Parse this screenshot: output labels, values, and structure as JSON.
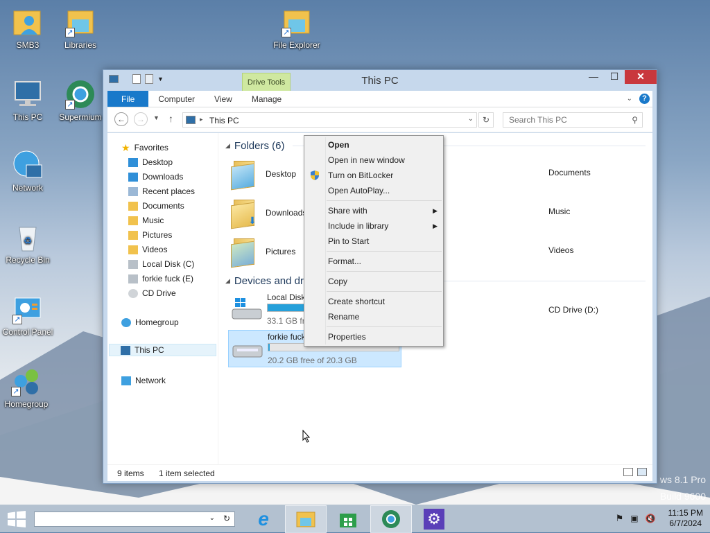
{
  "desktop": {
    "icons": [
      {
        "label": "SMB3"
      },
      {
        "label": "Libraries"
      },
      {
        "label": "File Explorer"
      },
      {
        "label": "This PC"
      },
      {
        "label": "Supermium"
      },
      {
        "label": "Network"
      },
      {
        "label": "Recycle Bin"
      },
      {
        "label": "Control Panel"
      },
      {
        "label": "Homegroup"
      }
    ],
    "watermark": {
      "line1": "ws 8.1 Pro",
      "line2": "Build 9600"
    }
  },
  "window": {
    "title": "This PC",
    "contextual_tab": "Drive Tools",
    "close_glyph": "✕",
    "minimize_glyph": "—",
    "maximize_glyph": "☐",
    "ribbon_tabs": [
      "File",
      "Computer",
      "View",
      "Manage"
    ],
    "help_glyph": "?",
    "address": {
      "path": "This PC"
    },
    "search": {
      "placeholder": "Search This PC"
    },
    "nav_pane": {
      "favorites_label": "Favorites",
      "items": [
        "Desktop",
        "Downloads",
        "Recent places",
        "Documents",
        "Music",
        "Pictures",
        "Videos",
        "Local Disk (C)",
        "forkie fuck (E)",
        "CD Drive"
      ],
      "homegroup": "Homegroup",
      "this_pc": "This PC",
      "network": "Network"
    },
    "folders_header": "Folders (6)",
    "folders": [
      "Desktop",
      "Downloads",
      "Pictures",
      "Documents",
      "Music",
      "Videos"
    ],
    "devices_header": "Devices and drives (3)",
    "drives": [
      {
        "name": "Local Disk (C:)",
        "free": "33.1 GB free of 59.6 GB",
        "used_fraction": 0.44
      },
      {
        "name": "forkie fuck (E:)",
        "free": "20.2 GB free of 20.3 GB",
        "used_fraction": 0.01
      },
      {
        "name": "CD Drive (D:)"
      }
    ],
    "status": {
      "items": "9 items",
      "selected": "1 item selected"
    }
  },
  "context_menu": {
    "items": [
      "Open",
      "Open in new window",
      "Turn on BitLocker",
      "Open AutoPlay...",
      "Share with",
      "Include in library",
      "Pin to Start",
      "Format...",
      "Copy",
      "Create shortcut",
      "Rename",
      "Properties"
    ]
  },
  "taskbar": {
    "time": "11:15 PM",
    "date": "6/7/2024"
  },
  "colors": {
    "accent": "#1979ca",
    "close": "#c9383d",
    "selection": "#cce8ff",
    "drive_bar": "#26a0da"
  }
}
